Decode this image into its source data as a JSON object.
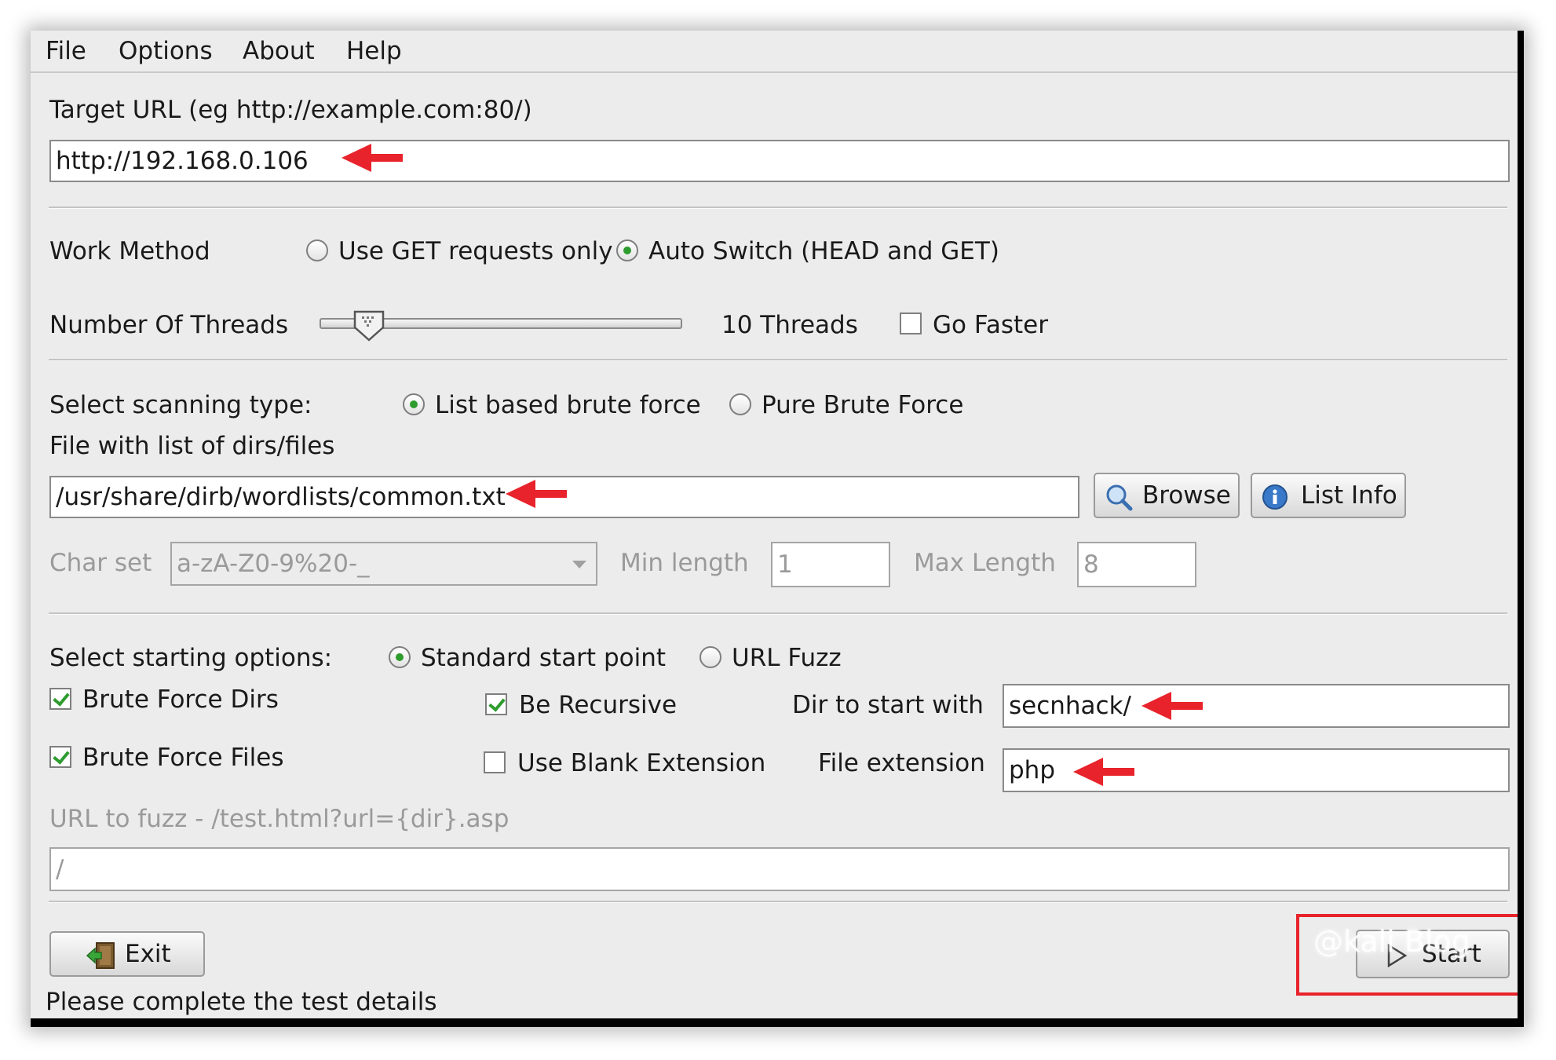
{
  "menu": [
    "File",
    "Options",
    "About",
    "Help"
  ],
  "target": {
    "label": "Target URL (eg http://example.com:80/)",
    "value": "http://192.168.0.106"
  },
  "work_method": {
    "label": "Work Method",
    "options": [
      "Use GET requests only",
      "Auto Switch (HEAD and GET)"
    ],
    "selected": "Auto Switch (HEAD and GET)"
  },
  "threads": {
    "label": "Number Of Threads",
    "value_label": "10 Threads",
    "slider_fraction": 0.1,
    "go_faster_label": "Go Faster",
    "go_faster_checked": false
  },
  "scan_type": {
    "label": "Select scanning type:",
    "options": [
      "List based brute force",
      "Pure Brute Force"
    ],
    "selected": "List based brute force"
  },
  "file_list": {
    "label": "File with list of dirs/files",
    "value": "/usr/share/dirb/wordlists/common.txt",
    "browse_label": "Browse",
    "list_info_label": "List Info"
  },
  "charset": {
    "label": "Char set",
    "value": "a-zA-Z0-9%20-_",
    "min_label": "Min length",
    "min_value": "1",
    "max_label": "Max Length",
    "max_value": "8"
  },
  "start_options": {
    "label": "Select starting options:",
    "options": [
      "Standard start point",
      "URL Fuzz"
    ],
    "selected": "Standard start point",
    "brute_dirs_label": "Brute Force Dirs",
    "brute_dirs_checked": true,
    "brute_files_label": "Brute Force Files",
    "brute_files_checked": true,
    "recursive_label": "Be Recursive",
    "recursive_checked": true,
    "blank_ext_label": "Use Blank Extension",
    "blank_ext_checked": false,
    "dir_label": "Dir to start with",
    "dir_value": "secnhack/",
    "ext_label": "File extension",
    "ext_value": "php"
  },
  "fuzz": {
    "label": "URL to fuzz - /test.html?url={dir}.asp",
    "value": "/"
  },
  "buttons": {
    "exit": "Exit",
    "start": "Start"
  },
  "status": "Please complete the test details",
  "watermark": "@kali Blog",
  "colors": {
    "annotation_red": "#e8232b",
    "radio_green": "#2e9c2e",
    "window_bg": "#ececec"
  }
}
